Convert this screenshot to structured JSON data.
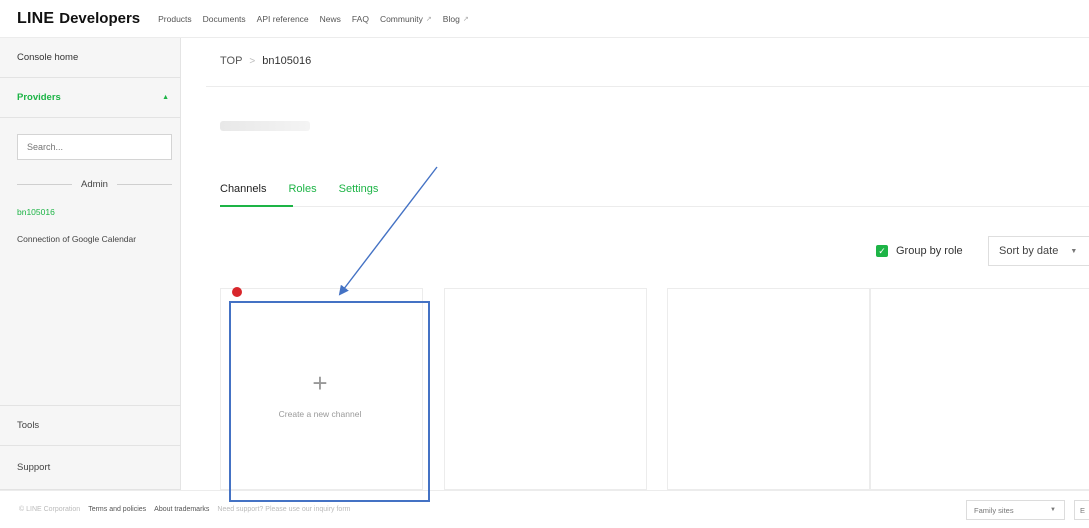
{
  "topnav": {
    "brand_line": "LINE",
    "brand_developers": "Developers",
    "items": [
      {
        "label": "Products",
        "external": false
      },
      {
        "label": "Documents",
        "external": false
      },
      {
        "label": "API reference",
        "external": false
      },
      {
        "label": "News",
        "external": false
      },
      {
        "label": "FAQ",
        "external": false
      },
      {
        "label": "Community",
        "external": true
      },
      {
        "label": "Blog",
        "external": true
      }
    ],
    "external_icon": "↗"
  },
  "sidebar": {
    "console_home": "Console home",
    "providers": "Providers",
    "providers_caret": "▲",
    "search_placeholder": "Search...",
    "admin_label": "Admin",
    "provider_links": [
      "bn105016",
      "Connection of Google Calendar"
    ],
    "tools": "Tools",
    "support": "Support"
  },
  "main": {
    "breadcrumb": {
      "root": "TOP",
      "separator": ">",
      "current": "bn105016"
    },
    "tabs": [
      {
        "label": "Channels",
        "active": true
      },
      {
        "label": "Roles",
        "active": false
      },
      {
        "label": "Settings",
        "active": false
      }
    ],
    "group_by_role": {
      "label": "Group by role",
      "checked": true,
      "check_glyph": "✓"
    },
    "sort": {
      "label": "Sort by date",
      "caret": "▼"
    },
    "create_card": {
      "plus": "+",
      "label": "Create a new channel"
    }
  },
  "footer": {
    "copyright": "© LINE Corporation",
    "links": [
      "Terms and policies",
      "About trademarks"
    ],
    "faded_note": "Need support? Please use our inquiry form",
    "family_sites": "Family sites",
    "family_caret": "▼",
    "language": "E"
  },
  "colors": {
    "brand_green": "#1db446",
    "annotation_blue": "#4472c4",
    "status_red": "#d8262b"
  }
}
